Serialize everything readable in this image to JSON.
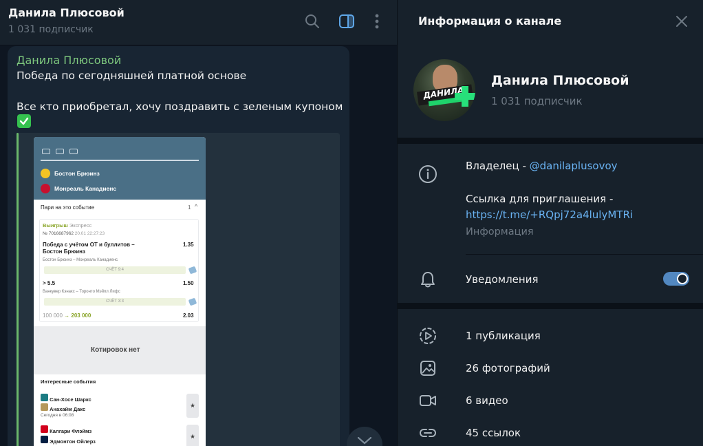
{
  "chat": {
    "title": "Данила Плюсовой",
    "subscribers": "1 031 подписчик"
  },
  "message": {
    "author": "Данила Плюсовой",
    "line1": "Победа по сегодняшней платной основе",
    "line2": "Все кто приобретал, хочу поздравить с зеленым купоном",
    "emoji": "check-mark-button"
  },
  "screenshot": {
    "team1": "Бостон Брюинз",
    "team2": "Монреаль Канадиенс",
    "bets_header": "Пари на это событие",
    "bets_count": "1",
    "status": "Выигрыш",
    "bet_type": "Экспресс",
    "bet_number": "№ 7016687962",
    "bet_date": "20.01  22:27:23",
    "sel1_title_1": "Победа с учётом ОТ и буллитов –",
    "sel1_title_2": "Бостон Брюинз",
    "sel1_odds": "1.35",
    "sel1_match": "Бостон Брюинз – Монреаль Канадиенс",
    "sel1_score": "СЧЁТ  9:4",
    "sel2_title": "> 5.5",
    "sel2_odds": "1.50",
    "sel2_match": "Ванкувер Кэнакс – Торонто Мэйпл Лифс",
    "sel2_score": "СЧЁТ  3:3",
    "stake": "100 000",
    "payout": "→ 203 000",
    "total_odds": "2.03",
    "no_quotes": "Котировок нет",
    "interesting": "Интересные события",
    "ev1_team1": "Сан-Хосе Шаркс",
    "ev1_team2": "Анахайм Дакс",
    "ev1_time": "Сегодня в 06:08",
    "ev2_team1": "Калгари Флэймз",
    "ev2_team2": "Эдмонтон Ойлерз"
  },
  "info": {
    "title": "Информация о канале",
    "name": "Данила Плюсовой",
    "subscribers": "1 031 подписчик",
    "avatar_text": "ДАНИЛА",
    "owner_label": "Владелец - ",
    "owner_handle": "@danilaplusovoy",
    "invite_label": "Ссылка для приглашения -",
    "invite_link": "https://t.me/+RQpj72a4lulyMTRi",
    "info_caption": "Информация",
    "notifications": "Уведомления",
    "notifications_on": true,
    "publications": "1 публикация",
    "photos": "26 фотографий",
    "videos": "6 видео",
    "links": "45 ссылок"
  },
  "colors": {
    "background": "#0e1621",
    "panel": "#17212b",
    "accent": "#5288c1",
    "link": "#6ab3f3",
    "author": "#7ec87e"
  }
}
